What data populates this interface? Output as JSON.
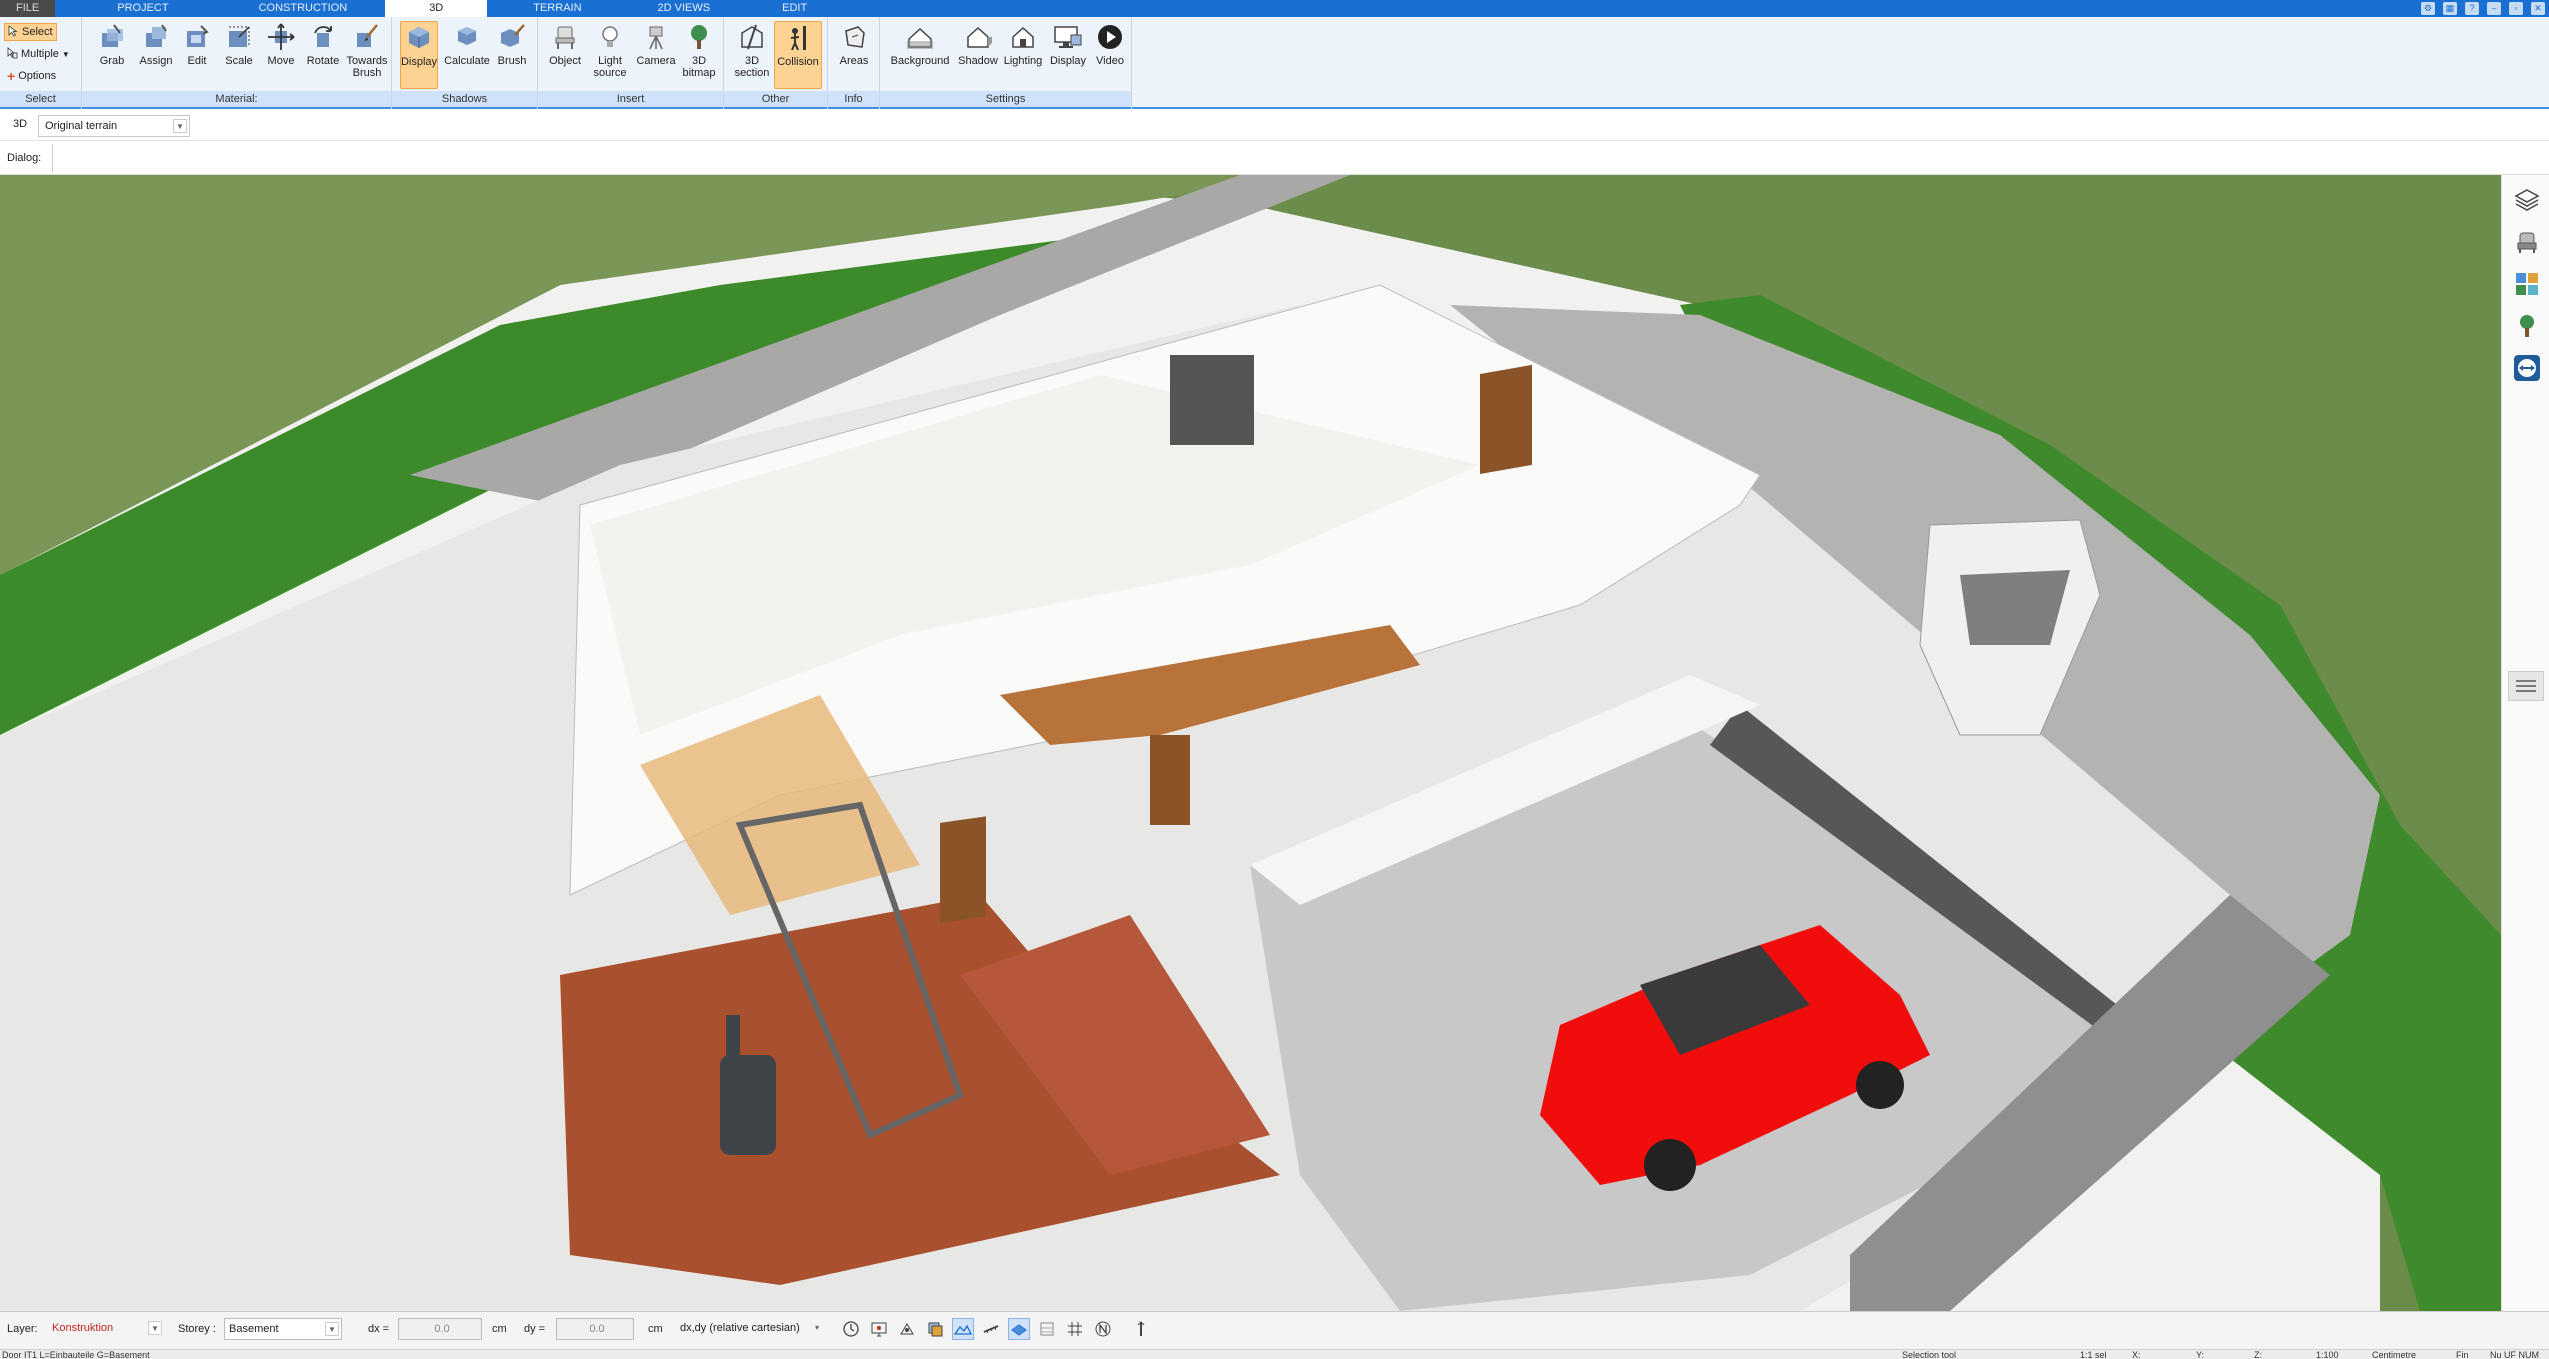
{
  "tabs": [
    {
      "label": "FILE"
    },
    {
      "label": "PROJECT"
    },
    {
      "label": "CONSTRUCTION"
    },
    {
      "label": "3D"
    },
    {
      "label": "TERRAIN"
    },
    {
      "label": "2D VIEWS"
    },
    {
      "label": "EDIT"
    }
  ],
  "window_controls": {
    "help": "?",
    "minimize": "–",
    "restore": "▫",
    "close": "✕"
  },
  "ribbon": {
    "select": {
      "select_label": "Select",
      "multiple_label": "Multiple",
      "options_label": "Options",
      "group": "Select"
    },
    "material": {
      "buttons": [
        "Grab",
        "Assign",
        "Edit",
        "Scale",
        "Move",
        "Rotate",
        "Towards Brush"
      ],
      "group": "Material:"
    },
    "shadows": {
      "buttons": [
        "Display",
        "Calculate",
        "Brush"
      ],
      "group": "Shadows"
    },
    "insert": {
      "buttons": [
        "Object",
        "Light source",
        "Camera",
        "3D bitmap"
      ],
      "group": "Insert"
    },
    "other": {
      "buttons": [
        "3D section",
        "Collision"
      ],
      "group": "Other"
    },
    "info": {
      "buttons": [
        "Areas"
      ],
      "group": "Info"
    },
    "settings": {
      "buttons": [
        "Background",
        "Shadow",
        "Lighting",
        "Display",
        "Video"
      ],
      "group": "Settings"
    }
  },
  "viewbar": {
    "view_label": "3D",
    "terrain_value": "Original terrain"
  },
  "dialog": {
    "label": "Dialog:"
  },
  "statusbar": {
    "layer_label": "Layer:",
    "layer_value": "Konstruktion",
    "storey_label": "Storey :",
    "storey_value": "Basement",
    "dx_label": "dx =",
    "dx_value": "0.0",
    "dx_unit": "cm",
    "dy_label": "dy =",
    "dy_value": "0.0",
    "dy_unit": "cm",
    "coord_mode": "dx,dy (relative cartesian)"
  },
  "infobar": {
    "left": "Door IT1 L=Einbauteile G=Basement",
    "tool": "Selection tool",
    "sel": "1:1 sel",
    "x": "X:",
    "y": "Y:",
    "z": "Z:",
    "scale": "1:100",
    "unit": "Centimetre",
    "state": "Fin",
    "keys": "Nu UF NUM"
  },
  "colors": {
    "tabbar": "#1a6fd3",
    "ribbon": "#edf3fb",
    "active_button": "#fcd392",
    "car": "#f20d0d",
    "grass": "#3f8a2c",
    "floor_wood": "#a9502e"
  }
}
